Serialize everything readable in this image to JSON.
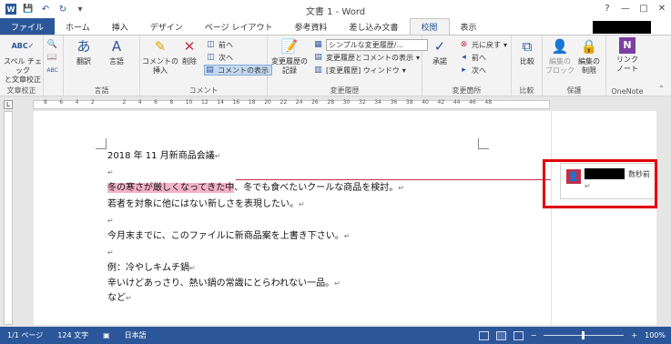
{
  "window": {
    "title": "文書 1 - Word",
    "help": "?",
    "minimize": "—",
    "maximize": "□",
    "close": "✕"
  },
  "quick_access": {
    "save": "💾",
    "undo": "↶",
    "redo": "↻",
    "customize": "▾"
  },
  "tabs": [
    "ファイル",
    "ホーム",
    "挿入",
    "デザイン",
    "ページ レイアウト",
    "参考資料",
    "差し込み文書",
    "校閲",
    "表示"
  ],
  "active_tab": "校閲",
  "ribbon": {
    "proofing": {
      "label": "文章校正",
      "spell": "スペル チェックと文章校正",
      "spell_l1": "スペル チェック",
      "spell_l2": "と文章校正"
    },
    "language": {
      "label": "言語",
      "translate": "翻訳",
      "language": "言語"
    },
    "comments": {
      "label": "コメント",
      "new": "コメントの",
      "new2": "挿入",
      "delete": "削除",
      "prev": "前へ",
      "next": "次へ",
      "show": "コメントの表示"
    },
    "tracking": {
      "label": "変更履歴",
      "track1": "変更履歴の",
      "track2": "記録",
      "markup": "シンプルな変更履歴/...",
      "show_markup": "変更履歴とコメントの表示",
      "pane": "[変更履歴] ウィンドウ"
    },
    "changes": {
      "label": "変更箇所",
      "accept": "承諾",
      "reject": "元に戻す",
      "prev": "前へ",
      "next": "次へ"
    },
    "compare": {
      "label": "比較",
      "compare": "比較"
    },
    "protect": {
      "label": "保護",
      "block1": "編集の",
      "block2": "ブロック",
      "restrict1": "編集の",
      "restrict2": "制限"
    },
    "onenote": {
      "label": "OneNote",
      "linked1": "リンク",
      "linked2": "ノート"
    }
  },
  "ruler": {
    "numbers": [
      "8",
      "6",
      "4",
      "2",
      "",
      "2",
      "4",
      "6",
      "8",
      "10",
      "12",
      "14",
      "16",
      "18",
      "20",
      "22",
      "24",
      "26",
      "28",
      "30",
      "32",
      "34",
      "36",
      "38",
      "40",
      "42",
      "44",
      "46",
      "48"
    ]
  },
  "document": {
    "lines": [
      {
        "text": "2018 年 11 月新商品会議",
        "highlight": ""
      },
      {
        "text": "",
        "highlight": ""
      },
      {
        "text": "、冬でも食べたいクールな商品を検討。",
        "highlight": "冬の寒さが厳しくなってきた中"
      },
      {
        "text": "若者を対象に他にはない新しさを表現したい。",
        "highlight": ""
      },
      {
        "text": "",
        "highlight": ""
      },
      {
        "text": "今月末までに、このファイルに新商品案を上書き下さい。",
        "highlight": ""
      },
      {
        "text": "",
        "highlight": ""
      },
      {
        "text": "例：冷やしキムチ鍋",
        "highlight": ""
      },
      {
        "text": "辛いけどあっさり、熱い鍋の常識にとらわれない一品。",
        "highlight": ""
      },
      {
        "text": "など",
        "highlight": ""
      }
    ],
    "para_mark": "↵"
  },
  "comment": {
    "time": "数秒前",
    "body": "↵"
  },
  "status": {
    "page": "1/1 ページ",
    "words": "124 文字",
    "language": "日本語",
    "zoom": "100%"
  },
  "colors": {
    "accent": "#2b579a",
    "highlight": "#f4b3c8",
    "comment": "#c0314a",
    "frame": "#e00000"
  }
}
